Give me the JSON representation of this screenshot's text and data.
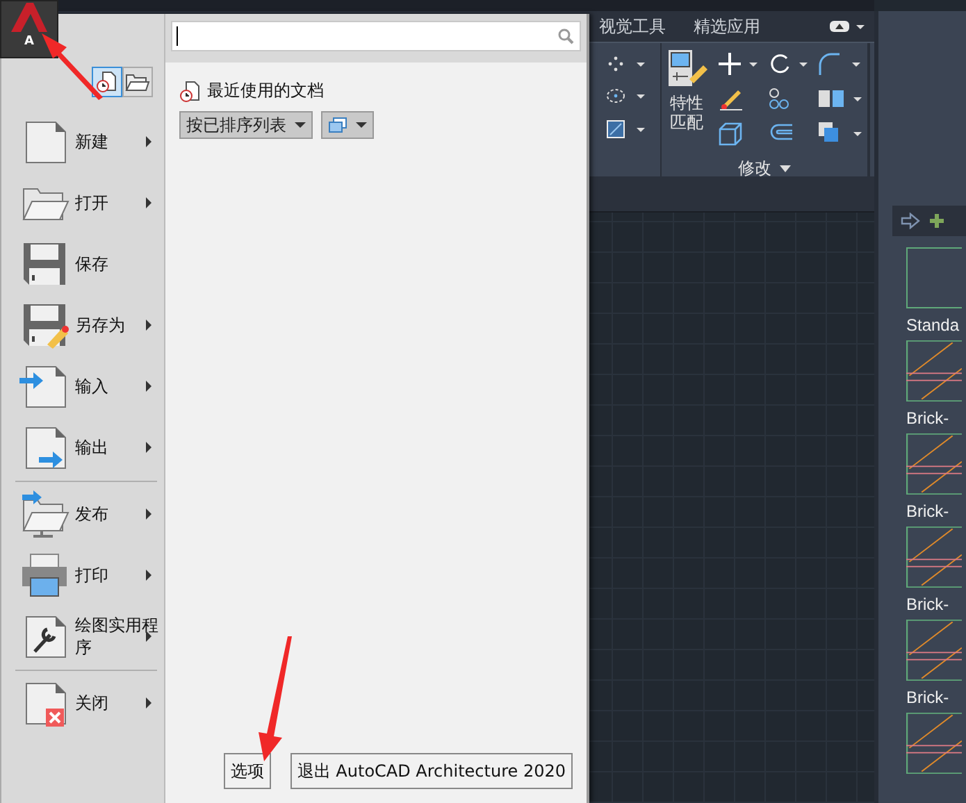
{
  "app_button": {
    "label": "A"
  },
  "ribbon": {
    "tabs": [
      {
        "label": "视觉工具",
        "selected": false
      },
      {
        "label": "精选应用",
        "selected": false
      }
    ],
    "panel": {
      "tool_lines": [
        "特性",
        "匹配"
      ],
      "title": "修改"
    }
  },
  "palette": {
    "items": [
      {
        "kind": "standard",
        "label": "Standa"
      },
      {
        "kind": "brick",
        "label": "Brick-"
      },
      {
        "kind": "brick",
        "label": "Brick-"
      },
      {
        "kind": "brick",
        "label": "Brick-"
      },
      {
        "kind": "brick",
        "label": "Brick-"
      },
      {
        "kind": "brick"
      }
    ]
  },
  "app_menu": {
    "view_toggles": [
      {
        "kind": "recent",
        "selected": true
      },
      {
        "kind": "open",
        "selected": false
      }
    ],
    "groups": [
      [
        {
          "kind": "new",
          "label": "新建",
          "submenu": true
        },
        {
          "kind": "open",
          "label": "打开",
          "submenu": true
        },
        {
          "kind": "save",
          "label": "保存",
          "submenu": false
        },
        {
          "kind": "saveas",
          "label": "另存为",
          "submenu": true
        },
        {
          "kind": "import",
          "label": "输入",
          "submenu": true
        },
        {
          "kind": "export",
          "label": "输出",
          "submenu": true
        }
      ],
      [
        {
          "kind": "publish",
          "label": "发布",
          "submenu": true
        },
        {
          "kind": "print",
          "label": "打印",
          "submenu": true
        },
        {
          "kind": "utilities",
          "label": "绘图实用程序",
          "submenu": true
        }
      ],
      [
        {
          "kind": "close",
          "label": "关闭",
          "submenu": true
        }
      ]
    ],
    "recent": {
      "title": "最近使用的文档",
      "sort_label": "按已排序列表"
    },
    "buttons": [
      "选项",
      "退出 AutoCAD Architecture 2020"
    ]
  }
}
